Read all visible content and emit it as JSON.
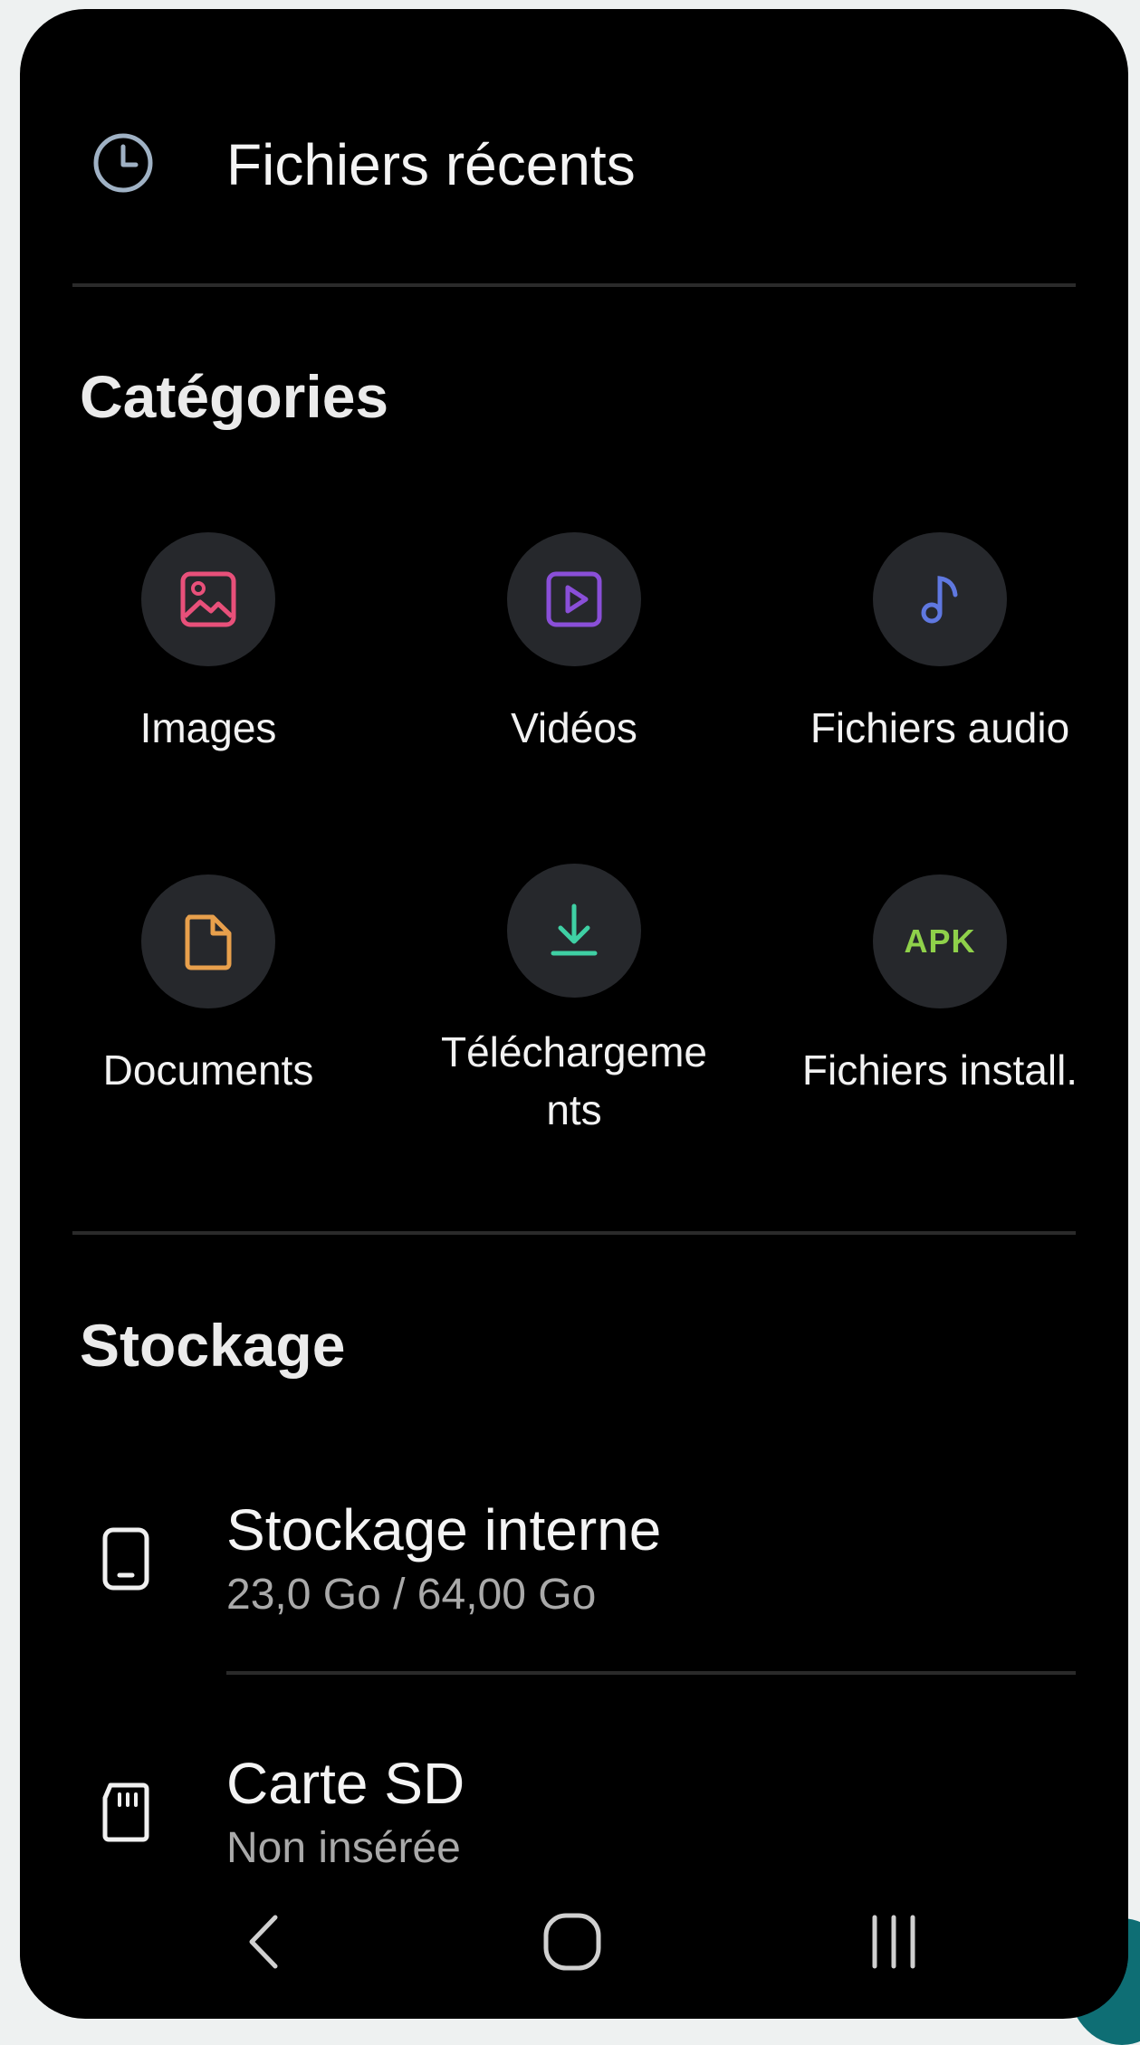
{
  "recent": {
    "label": "Fichiers récents",
    "icon": "clock-icon"
  },
  "categories": {
    "title": "Catégories",
    "items": [
      {
        "label": "Images",
        "icon": "image-icon",
        "color": "#e8507a"
      },
      {
        "label": "Vidéos",
        "icon": "video-icon",
        "color": "#8a4fd8"
      },
      {
        "label": "Fichiers audio",
        "icon": "music-note-icon",
        "color": "#5f78e0"
      },
      {
        "label": "Documents",
        "icon": "document-icon",
        "color": "#e8a04c"
      },
      {
        "label": "Téléchargeme\nnts",
        "icon": "download-icon",
        "color": "#3fd0a4"
      },
      {
        "label": "Fichiers install.",
        "icon": "apk-icon",
        "icon_text": "APK",
        "color": "#8fd14a"
      }
    ]
  },
  "storage": {
    "title": "Stockage",
    "items": [
      {
        "title": "Stockage interne",
        "subtitle": "23,0 Go / 64,00 Go",
        "icon": "phone-icon"
      },
      {
        "title": "Carte SD",
        "subtitle": "Non insérée",
        "icon": "sd-card-icon"
      }
    ]
  },
  "navbar": {
    "back_icon": "back-chevron-icon",
    "home_icon": "home-icon",
    "recents_icon": "recent-apps-icon"
  }
}
